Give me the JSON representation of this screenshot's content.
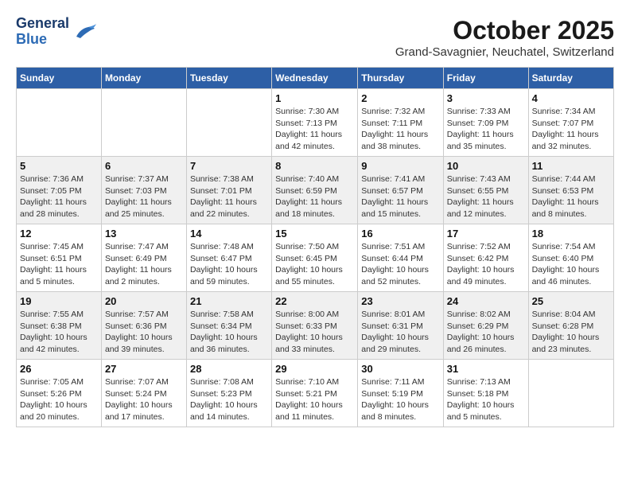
{
  "header": {
    "logo": {
      "general": "General",
      "blue": "Blue"
    },
    "title": "October 2025",
    "subtitle": "Grand-Savagnier, Neuchatel, Switzerland"
  },
  "days_of_week": [
    "Sunday",
    "Monday",
    "Tuesday",
    "Wednesday",
    "Thursday",
    "Friday",
    "Saturday"
  ],
  "weeks": [
    [
      {
        "day": "",
        "info": ""
      },
      {
        "day": "",
        "info": ""
      },
      {
        "day": "",
        "info": ""
      },
      {
        "day": "1",
        "info": "Sunrise: 7:30 AM\nSunset: 7:13 PM\nDaylight: 11 hours and 42 minutes."
      },
      {
        "day": "2",
        "info": "Sunrise: 7:32 AM\nSunset: 7:11 PM\nDaylight: 11 hours and 38 minutes."
      },
      {
        "day": "3",
        "info": "Sunrise: 7:33 AM\nSunset: 7:09 PM\nDaylight: 11 hours and 35 minutes."
      },
      {
        "day": "4",
        "info": "Sunrise: 7:34 AM\nSunset: 7:07 PM\nDaylight: 11 hours and 32 minutes."
      }
    ],
    [
      {
        "day": "5",
        "info": "Sunrise: 7:36 AM\nSunset: 7:05 PM\nDaylight: 11 hours and 28 minutes."
      },
      {
        "day": "6",
        "info": "Sunrise: 7:37 AM\nSunset: 7:03 PM\nDaylight: 11 hours and 25 minutes."
      },
      {
        "day": "7",
        "info": "Sunrise: 7:38 AM\nSunset: 7:01 PM\nDaylight: 11 hours and 22 minutes."
      },
      {
        "day": "8",
        "info": "Sunrise: 7:40 AM\nSunset: 6:59 PM\nDaylight: 11 hours and 18 minutes."
      },
      {
        "day": "9",
        "info": "Sunrise: 7:41 AM\nSunset: 6:57 PM\nDaylight: 11 hours and 15 minutes."
      },
      {
        "day": "10",
        "info": "Sunrise: 7:43 AM\nSunset: 6:55 PM\nDaylight: 11 hours and 12 minutes."
      },
      {
        "day": "11",
        "info": "Sunrise: 7:44 AM\nSunset: 6:53 PM\nDaylight: 11 hours and 8 minutes."
      }
    ],
    [
      {
        "day": "12",
        "info": "Sunrise: 7:45 AM\nSunset: 6:51 PM\nDaylight: 11 hours and 5 minutes."
      },
      {
        "day": "13",
        "info": "Sunrise: 7:47 AM\nSunset: 6:49 PM\nDaylight: 11 hours and 2 minutes."
      },
      {
        "day": "14",
        "info": "Sunrise: 7:48 AM\nSunset: 6:47 PM\nDaylight: 10 hours and 59 minutes."
      },
      {
        "day": "15",
        "info": "Sunrise: 7:50 AM\nSunset: 6:45 PM\nDaylight: 10 hours and 55 minutes."
      },
      {
        "day": "16",
        "info": "Sunrise: 7:51 AM\nSunset: 6:44 PM\nDaylight: 10 hours and 52 minutes."
      },
      {
        "day": "17",
        "info": "Sunrise: 7:52 AM\nSunset: 6:42 PM\nDaylight: 10 hours and 49 minutes."
      },
      {
        "day": "18",
        "info": "Sunrise: 7:54 AM\nSunset: 6:40 PM\nDaylight: 10 hours and 46 minutes."
      }
    ],
    [
      {
        "day": "19",
        "info": "Sunrise: 7:55 AM\nSunset: 6:38 PM\nDaylight: 10 hours and 42 minutes."
      },
      {
        "day": "20",
        "info": "Sunrise: 7:57 AM\nSunset: 6:36 PM\nDaylight: 10 hours and 39 minutes."
      },
      {
        "day": "21",
        "info": "Sunrise: 7:58 AM\nSunset: 6:34 PM\nDaylight: 10 hours and 36 minutes."
      },
      {
        "day": "22",
        "info": "Sunrise: 8:00 AM\nSunset: 6:33 PM\nDaylight: 10 hours and 33 minutes."
      },
      {
        "day": "23",
        "info": "Sunrise: 8:01 AM\nSunset: 6:31 PM\nDaylight: 10 hours and 29 minutes."
      },
      {
        "day": "24",
        "info": "Sunrise: 8:02 AM\nSunset: 6:29 PM\nDaylight: 10 hours and 26 minutes."
      },
      {
        "day": "25",
        "info": "Sunrise: 8:04 AM\nSunset: 6:28 PM\nDaylight: 10 hours and 23 minutes."
      }
    ],
    [
      {
        "day": "26",
        "info": "Sunrise: 7:05 AM\nSunset: 5:26 PM\nDaylight: 10 hours and 20 minutes."
      },
      {
        "day": "27",
        "info": "Sunrise: 7:07 AM\nSunset: 5:24 PM\nDaylight: 10 hours and 17 minutes."
      },
      {
        "day": "28",
        "info": "Sunrise: 7:08 AM\nSunset: 5:23 PM\nDaylight: 10 hours and 14 minutes."
      },
      {
        "day": "29",
        "info": "Sunrise: 7:10 AM\nSunset: 5:21 PM\nDaylight: 10 hours and 11 minutes."
      },
      {
        "day": "30",
        "info": "Sunrise: 7:11 AM\nSunset: 5:19 PM\nDaylight: 10 hours and 8 minutes."
      },
      {
        "day": "31",
        "info": "Sunrise: 7:13 AM\nSunset: 5:18 PM\nDaylight: 10 hours and 5 minutes."
      },
      {
        "day": "",
        "info": ""
      }
    ]
  ]
}
